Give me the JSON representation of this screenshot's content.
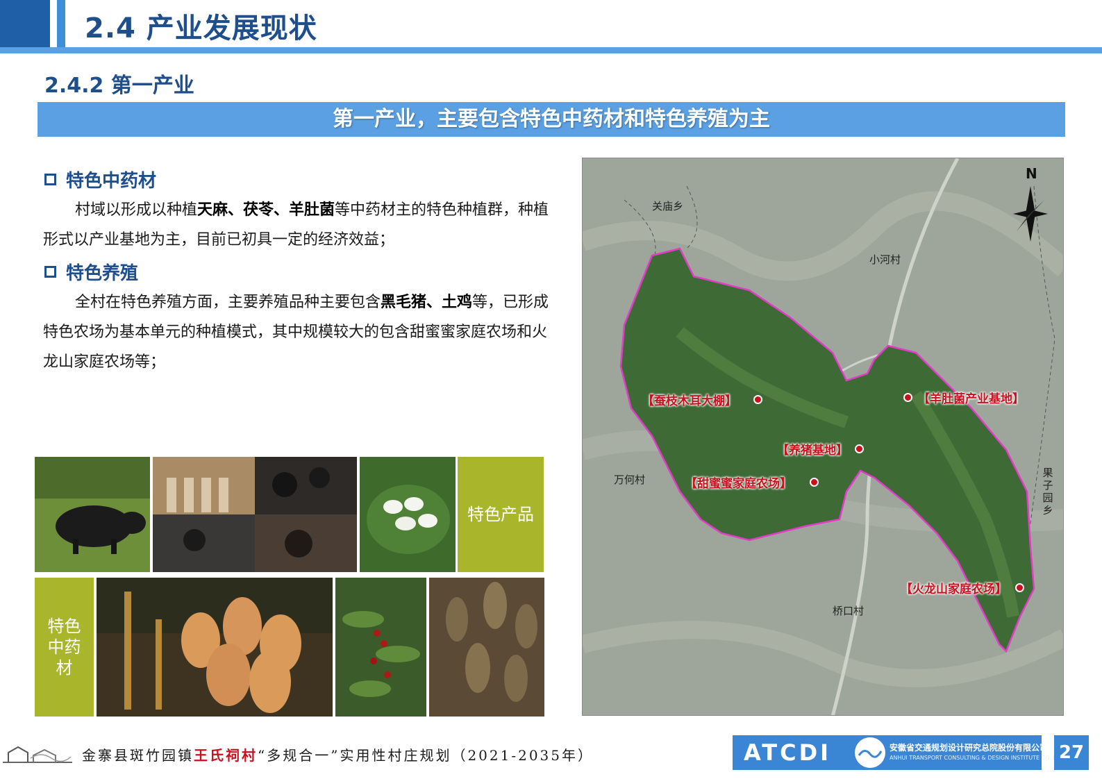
{
  "header": {
    "title": "2.4 产业发展现状"
  },
  "subsection": {
    "title": "2.4.2 第一产业"
  },
  "banner": {
    "text": "第一产业，主要包含特色中药材和特色养殖为主"
  },
  "sections": [
    {
      "heading": "特色中药材",
      "para": {
        "t1": "村域以形成以种植",
        "b1": "天麻、茯苓、羊肚菌",
        "t2": "等中药材主的特色种植群，种植形式以产业基地为主，目前已初具一定的经济效益；"
      }
    },
    {
      "heading": "特色养殖",
      "para": {
        "t1": "全村在特色养殖方面，主要养殖品种主要包含",
        "b1": "黑毛猪、土鸡",
        "t2": "等，已形成特色农场为基本单元的种植模式，其中规模较大的包含甜蜜蜜家庭农场和火龙山家庭农场等；"
      }
    }
  ],
  "photo_labels": {
    "products": "特色产品",
    "herbs": "特色中药材"
  },
  "map": {
    "north": "N",
    "places": {
      "guanmiao": "关庙乡",
      "xiaohe": "小河村",
      "wanhe": "万何村",
      "guoziyuan": "果子园乡",
      "qiaokou": "桥口村"
    },
    "pois": {
      "mu_er": "【蚕枝木耳大棚】",
      "yang_du_jun": "【羊肚菌产业基地】",
      "yang_zhu": "【养猪基地】",
      "tian_mi_mi": "【甜蜜蜜家庭农场】",
      "huo_long_shan": "【火龙山家庭农场】"
    },
    "colors": {
      "boundary": "#e23cc8",
      "poi": "#c8101e"
    }
  },
  "footer": {
    "pre": "金寨县斑竹园镇",
    "village": "王氏祠村",
    "post": "“多规合一”实用性村庄规划（2021-2035年）",
    "logo_text": "ATCDI",
    "company_cn": "安徽省交通规划设计研究总院股份有限公司",
    "company_en": "ANHUI TRANSPORT CONSULTING & DESIGN INSTITUTE CO.,LTD.",
    "page": "27"
  }
}
